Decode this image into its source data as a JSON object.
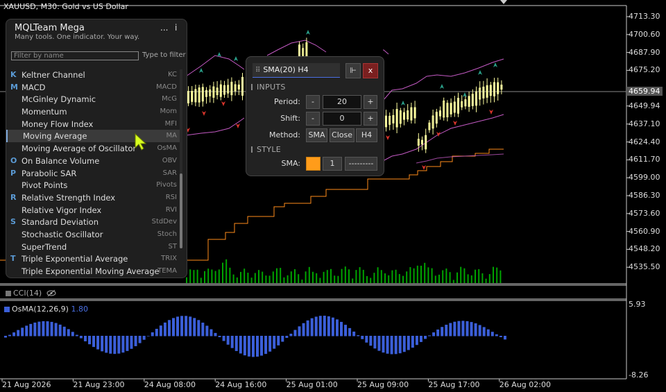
{
  "chart": {
    "title": "XAUUSD, M30:  Gold vs US Dollar",
    "current_price": "4659.94",
    "price_labels": [
      "4713.30",
      "4700.60",
      "4687.90",
      "4675.20",
      "4649.94",
      "4637.10",
      "4624.40",
      "4611.70",
      "4599.00",
      "4586.30",
      "4573.60",
      "4560.90",
      "4548.20",
      "4535.50"
    ],
    "time_labels": [
      "21 Aug 2026",
      "21 Aug 23:00",
      "24 Aug 08:00",
      "24 Aug 16:00",
      "25 Aug 01:00",
      "25 Aug 09:00",
      "25 Aug 17:00",
      "26 Aug 02:00"
    ],
    "osc_max": "5.93",
    "osc_min": "-8.26",
    "cci_label": "CCI(14)",
    "osma_label": "OsMA(12,26,9)",
    "osma_value": "1.80",
    "colors": {
      "candle": "#ffff9f",
      "bands": "#c45ac4",
      "sma": "#ff8c1a",
      "volume": "#00a300",
      "osma": "#3b5fd9",
      "arrow_up": "#2aa08a",
      "arrow_down": "#d9342b"
    }
  },
  "panel": {
    "title": "MQLTeam Mega",
    "subtitle": "Many tools. One indicator. Your way.",
    "menu": "...",
    "info": "i",
    "filter_placeholder": "Filter by name",
    "filter_hint": "Type to filter",
    "items": [
      {
        "letter": "K",
        "name": "Keltner Channel",
        "abbr": "KC"
      },
      {
        "letter": "M",
        "name": "MACD",
        "abbr": "MACD"
      },
      {
        "letter": "",
        "name": "McGinley Dynamic",
        "abbr": "McG"
      },
      {
        "letter": "",
        "name": "Momentum",
        "abbr": "Mom"
      },
      {
        "letter": "",
        "name": "Money Flow Index",
        "abbr": "MFI"
      },
      {
        "letter": "",
        "name": "Moving Average",
        "abbr": "MA"
      },
      {
        "letter": "",
        "name": "Moving Average of Oscillator",
        "abbr": "OsMA"
      },
      {
        "letter": "O",
        "name": "On Balance Volume",
        "abbr": "OBV"
      },
      {
        "letter": "P",
        "name": "Parabolic SAR",
        "abbr": "SAR"
      },
      {
        "letter": "",
        "name": "Pivot Points",
        "abbr": "Pivots"
      },
      {
        "letter": "R",
        "name": "Relative Strength Index",
        "abbr": "RSI"
      },
      {
        "letter": "",
        "name": "Relative Vigor Index",
        "abbr": "RVI"
      },
      {
        "letter": "S",
        "name": "Standard Deviation",
        "abbr": "StdDev"
      },
      {
        "letter": "",
        "name": "Stochastic Oscillator",
        "abbr": "Stoch"
      },
      {
        "letter": "",
        "name": "SuperTrend",
        "abbr": "ST"
      },
      {
        "letter": "T",
        "name": "Triple Exponential Average",
        "abbr": "TRIX"
      },
      {
        "letter": "",
        "name": "Triple Exponential Moving Average",
        "abbr": "TEMA"
      }
    ]
  },
  "dialog": {
    "title": "SMA(20) H4",
    "grip": "⠿",
    "pin": "⊩",
    "close": "x",
    "inputs_heading": "INPUTS",
    "period_label": "Period:",
    "period_value": "20",
    "shift_label": "Shift:",
    "shift_value": "0",
    "minus": "-",
    "plus": "+",
    "method_label": "Method:",
    "method_value": "SMA",
    "close_btn": "Close",
    "timeframe": "H4",
    "style_heading": "STYLE",
    "sma_label": "SMA:",
    "width_value": "1",
    "line_style": "---------"
  }
}
